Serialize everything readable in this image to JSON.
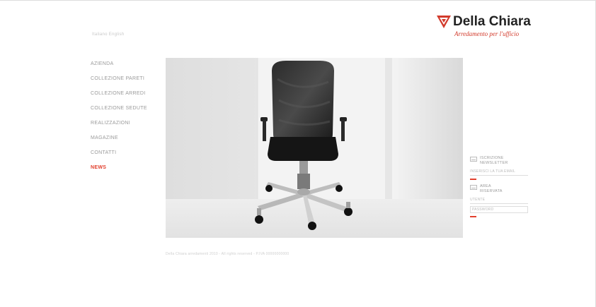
{
  "header": {
    "language_links": "Italiano  English",
    "logo": {
      "brand": "Della Chiara",
      "tagline": "Arredamento per l'ufficio",
      "brand_color": "#d23a2b"
    }
  },
  "nav": {
    "items": [
      {
        "label": "AZIENDA",
        "active": false
      },
      {
        "label": "COLLEZIONE PARETI",
        "active": false
      },
      {
        "label": "COLLEZIONE ARREDI",
        "active": false
      },
      {
        "label": "COLLEZIONE SEDUTE",
        "active": false
      },
      {
        "label": "REALIZZAZIONI",
        "active": false
      },
      {
        "label": "MAGAZINE",
        "active": false
      },
      {
        "label": "CONTATTI",
        "active": false
      },
      {
        "label": "NEWS",
        "active": true
      }
    ],
    "active_color": "#e2402e"
  },
  "hero": {
    "image_subject": "black mesh office chair on chrome five-star base in white room"
  },
  "sidebar": {
    "newsletter": {
      "label_line1": "ISCRIZIONE",
      "label_line2": "NEWSLETTER",
      "field_value": "INSERISCI LA TUA EMAIL",
      "icon": "mail-icon"
    },
    "reserved": {
      "label_line1": "AREA",
      "label_line2": "RISERVATA",
      "username_placeholder": "UTENTE",
      "password_placeholder": "PASSWORD",
      "icon": "lock-icon"
    },
    "accent_color": "#e2402e"
  },
  "footer": {
    "text": "Della Chiara arredamenti 2010 - All rights reserved - P.IVA 00000000000"
  }
}
